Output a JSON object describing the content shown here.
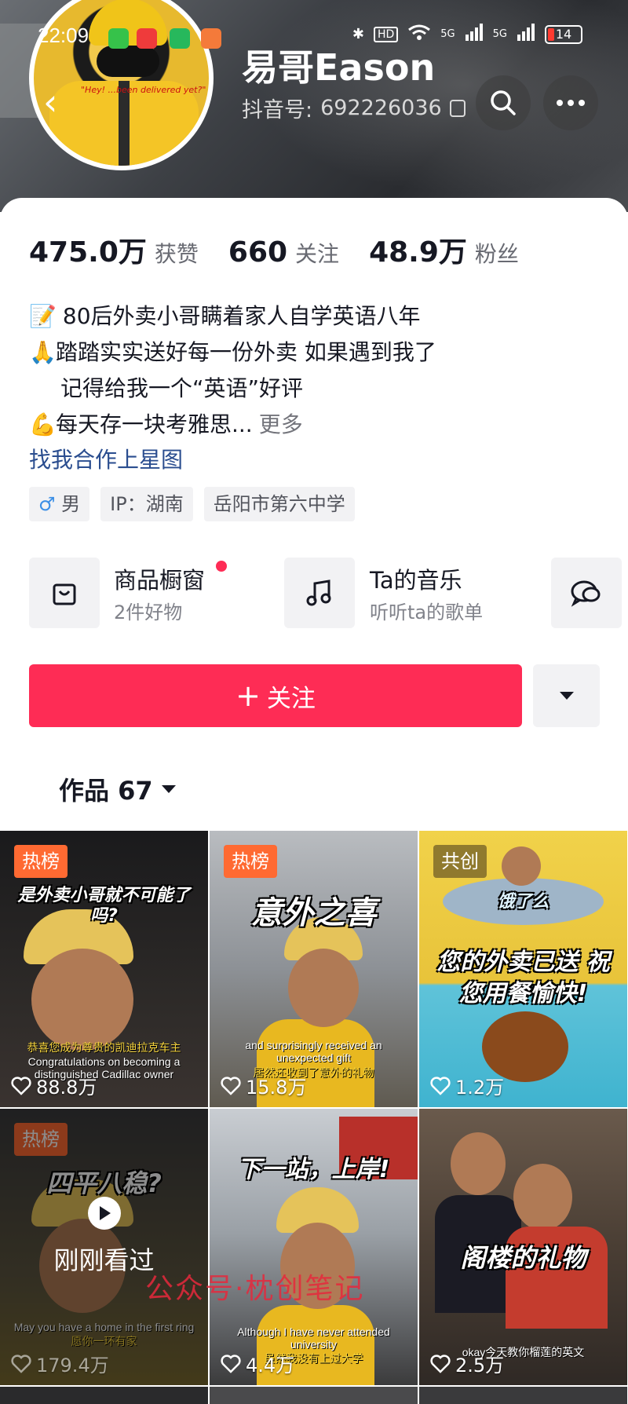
{
  "status_bar": {
    "time": "22:09",
    "network_1": "5G",
    "network_2": "5G",
    "hd": "HD",
    "battery": "14"
  },
  "profile": {
    "name": "易哥Eason",
    "handle_label": "抖音号:",
    "handle_value": "692226036",
    "avatar_caption": "\"Hey! ...been delivered yet?\""
  },
  "stats": {
    "likes_num": "475.0万",
    "likes_label": "获赞",
    "following_num": "660",
    "following_label": "关注",
    "fans_num": "48.9万",
    "fans_label": "粉丝"
  },
  "bio": {
    "line1_emoji": "📝",
    "line1": " 80后外卖小哥瞒着家人自学英语八年",
    "line2_emoji": "🙏",
    "line2": "踏踏实实送好每一份外卖 如果遇到我了",
    "line3": "记得给我一个“英语”好评",
    "line4_emoji": "💪",
    "line4": "每天存一块考雅思...",
    "more": "更多"
  },
  "star_link": "找我合作上星图",
  "tags": {
    "gender_symbol": "♂",
    "gender": "男",
    "ip": "IP：湖南",
    "school": "岳阳市第六中学"
  },
  "features": {
    "shop_title": "商品橱窗",
    "shop_sub": "2件好物",
    "music_title": "Ta的音乐",
    "music_sub": "听听ta的歌单"
  },
  "follow_button": "关注",
  "works_tab": "作品 67",
  "videos": [
    {
      "badge": "热榜",
      "headline": "是外卖小哥就不可能了吗?",
      "caption_cn": "恭喜您成为尊贵的凯迪拉克车主",
      "caption_en": "Congratulations on becoming a distinguished Cadillac owner",
      "likes": "88.8万"
    },
    {
      "badge": "热榜",
      "headline": "意外之喜",
      "caption_en": "and surprisingly received an unexpected gift",
      "caption_cn": "居然还收到了意外的礼物",
      "likes": "15.8万"
    },
    {
      "badge": "共创",
      "headline_top": "饿了么",
      "headline": "您的外卖已送 祝您用餐愉快!",
      "likes": "1.2万"
    },
    {
      "badge": "热榜",
      "headline": "四平八稳?",
      "watched": "刚刚看过",
      "caption_en": "May you have a home in the first ring",
      "caption_cn": "愿你一环有家",
      "likes": "179.4万"
    },
    {
      "headline": "下一站，上岸!",
      "caption_en": "Although I have never attended university",
      "caption_cn": "虽然我没有上过大学",
      "likes": "4.4万"
    },
    {
      "headline": "阁楼的礼物",
      "caption_cn": "okay今天教你榴莲的英文",
      "likes": "2.5万"
    }
  ],
  "watermark": "公众号·枕创笔记",
  "colors": {
    "accent": "#fe2c55",
    "link": "#2a4d8f",
    "hot_badge": "#ff6a32"
  }
}
